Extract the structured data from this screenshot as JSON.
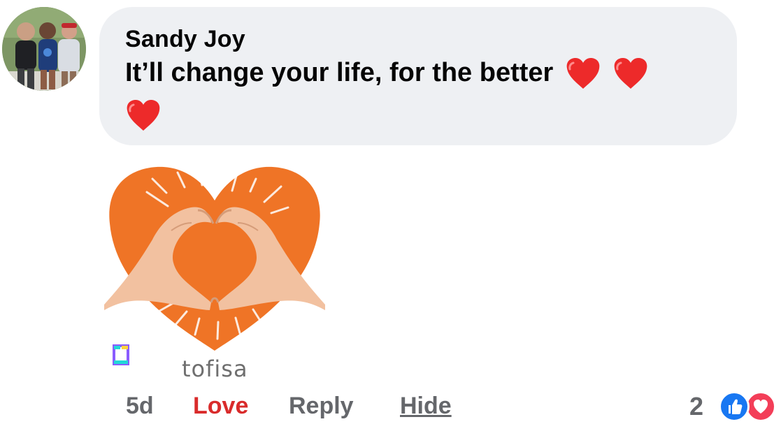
{
  "comment": {
    "author": "Sandy Joy",
    "text_line1": "It’ll change your life, for the better",
    "text_line2": "",
    "emoji_count": 3,
    "emoji_icon": "red-heart-icon"
  },
  "gif": {
    "wordmark": "tofisa",
    "icon": "heart-hands-icon"
  },
  "actions": {
    "timestamp": "5d",
    "love_label": "Love",
    "reply_label": "Reply",
    "hide_label": "Hide"
  },
  "reactions": {
    "count": "2",
    "icons": [
      "like-icon",
      "love-icon"
    ]
  },
  "colors": {
    "bubble": "#eef0f3",
    "love_text": "#d92b2b",
    "secondary_text": "#65676b",
    "like_blue": "#1877f2",
    "love_red": "#f33e58",
    "gif_orange": "#ef7426"
  }
}
